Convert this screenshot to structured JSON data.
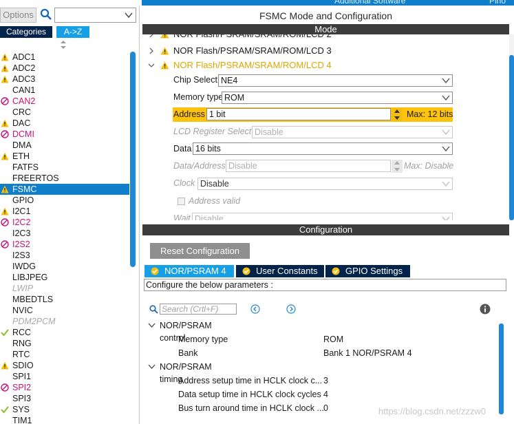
{
  "top_strip": {
    "right_text": "Additional Software",
    "right_text2": "Pino"
  },
  "left_panel": {
    "options_label": "Options",
    "search_value": "",
    "tabs": {
      "categories": "Categories",
      "atoz": "A->Z"
    },
    "peripherals": [
      {
        "label": "ADC1",
        "status": "warning"
      },
      {
        "label": "ADC2",
        "status": "warning"
      },
      {
        "label": "ADC3",
        "status": "warning"
      },
      {
        "label": "CAN1",
        "status": "none"
      },
      {
        "label": "CAN2",
        "status": "error"
      },
      {
        "label": "CRC",
        "status": "none"
      },
      {
        "label": "DAC",
        "status": "warning"
      },
      {
        "label": "DCMI",
        "status": "error"
      },
      {
        "label": "DMA",
        "status": "none"
      },
      {
        "label": "ETH",
        "status": "warning"
      },
      {
        "label": "FATFS",
        "status": "none"
      },
      {
        "label": "FREERTOS",
        "status": "none"
      },
      {
        "label": "FSMC",
        "status": "warning",
        "selected": true
      },
      {
        "label": "GPIO",
        "status": "none"
      },
      {
        "label": "I2C1",
        "status": "warning"
      },
      {
        "label": "I2C2",
        "status": "error"
      },
      {
        "label": "I2C3",
        "status": "none"
      },
      {
        "label": "I2S2",
        "status": "error"
      },
      {
        "label": "I2S3",
        "status": "none"
      },
      {
        "label": "IWDG",
        "status": "none"
      },
      {
        "label": "LIBJPEG",
        "status": "none"
      },
      {
        "label": "LWIP",
        "status": "disabled"
      },
      {
        "label": "MBEDTLS",
        "status": "none"
      },
      {
        "label": "NVIC",
        "status": "none"
      },
      {
        "label": "PDM2PCM",
        "status": "disabled"
      },
      {
        "label": "RCC",
        "status": "ok"
      },
      {
        "label": "RNG",
        "status": "none"
      },
      {
        "label": "RTC",
        "status": "none"
      },
      {
        "label": "SDIO",
        "status": "warning"
      },
      {
        "label": "SPI1",
        "status": "none"
      },
      {
        "label": "SPI2",
        "status": "error"
      },
      {
        "label": "SPI3",
        "status": "none"
      },
      {
        "label": "SYS",
        "status": "ok"
      },
      {
        "label": "TIM1",
        "status": "none"
      }
    ]
  },
  "mode_config": {
    "title": "FSMC Mode and Configuration",
    "mode_header": "Mode",
    "tree": {
      "partial_above": "NOR Flash/PSRAM/SRAM/ROM/LCD 2",
      "item3": "NOR Flash/PSRAM/SRAM/ROM/LCD 3",
      "item4": "NOR Flash/PSRAM/SRAM/ROM/LCD 4"
    },
    "fields": {
      "chip_select_label": "Chip Select",
      "chip_select_value": "NE4",
      "memory_type_label": "Memory type",
      "memory_type_value": "ROM",
      "address_label": "Address",
      "address_value": "1 bit",
      "address_max": "Max: 12 bits",
      "lcd_register_label": "LCD Register Select",
      "lcd_register_value": "Disable",
      "data_label": "Data",
      "data_value": "16 bits",
      "data_address_label": "Data/Address",
      "data_address_value": "Disable",
      "data_address_max": "Max: Disable",
      "clock_label": "Clock",
      "clock_value": "Disable",
      "address_valid_label": "Address valid",
      "wait_label": "Wait",
      "wait_value": "Disable"
    }
  },
  "configuration": {
    "header": "Configuration",
    "reset_button": "Reset Configuration",
    "tabs": [
      "NOR/PSRAM 4",
      "User Constants",
      "GPIO Settings"
    ],
    "instruction": "Configure the below parameters :",
    "search_placeholder": "Search (Crtl+F)",
    "groups": [
      {
        "label": "NOR/PSRAM control",
        "params": [
          {
            "name": "Memory type",
            "value": "ROM"
          },
          {
            "name": "Bank",
            "value": "Bank 1 NOR/PSRAM 4"
          }
        ]
      },
      {
        "label": "NOR/PSRAM timing",
        "params": [
          {
            "name": "Address setup time in HCLK clock c...",
            "value": "3"
          },
          {
            "name": "Data setup time in HCLK clock cycles",
            "value": "4"
          },
          {
            "name": "Bus turn around time in HCLK clock ...",
            "value": "0"
          }
        ]
      }
    ]
  },
  "watermark": "https://blog.csdn.net/zzzw0",
  "colors": {
    "accent_blue": "#0f7ecb",
    "warning_yellow": "#f5bf0f",
    "error_magenta": "#c8127a",
    "ok_green": "#8cbe1e",
    "dark_navy": "#03234b",
    "header_gray": "#3c3c3c"
  }
}
